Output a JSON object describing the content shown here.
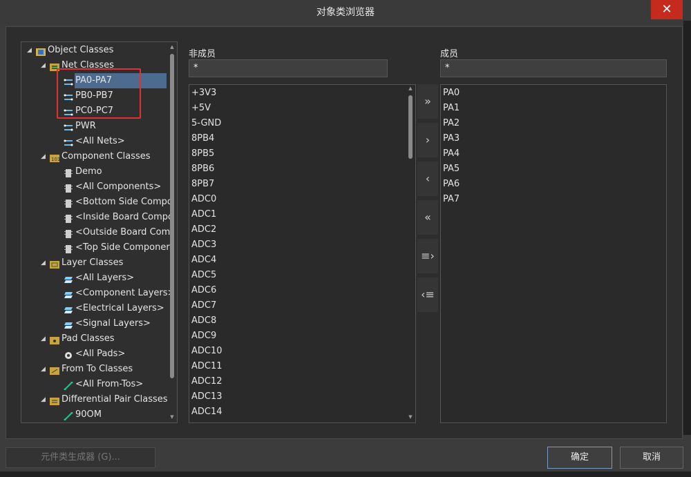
{
  "window": {
    "title": "对象类浏览器",
    "close": "✕"
  },
  "tree": {
    "rows": [
      {
        "label": "Object Classes",
        "exp": "◢",
        "icon": "root"
      },
      {
        "label": "Net Classes",
        "exp": "◢",
        "icon": "netfolder"
      },
      {
        "label": "PA0-PA7",
        "icon": "net",
        "selected": true
      },
      {
        "label": "PB0-PB7",
        "icon": "net"
      },
      {
        "label": "PC0-PC7",
        "icon": "net"
      },
      {
        "label": "PWR",
        "icon": "net"
      },
      {
        "label": "<All Nets>",
        "icon": "net"
      },
      {
        "label": "Component Classes",
        "exp": "◢",
        "icon": "compfolder"
      },
      {
        "label": "Demo",
        "icon": "comp"
      },
      {
        "label": "<All Components>",
        "icon": "comp"
      },
      {
        "label": "<Bottom Side Compo",
        "icon": "comp"
      },
      {
        "label": "<Inside Board Compo",
        "icon": "comp"
      },
      {
        "label": "<Outside Board Com",
        "icon": "comp"
      },
      {
        "label": "<Top Side Componer",
        "icon": "comp"
      },
      {
        "label": "Layer Classes",
        "exp": "◢",
        "icon": "layerfolder"
      },
      {
        "label": "<All Layers>",
        "icon": "layer"
      },
      {
        "label": "<Component Layers>",
        "icon": "layer"
      },
      {
        "label": "<Electrical Layers>",
        "icon": "layer"
      },
      {
        "label": "<Signal Layers>",
        "icon": "layer"
      },
      {
        "label": "Pad Classes",
        "exp": "◢",
        "icon": "padfolder"
      },
      {
        "label": "<All Pads>",
        "icon": "pad"
      },
      {
        "label": "From To Classes",
        "exp": "◢",
        "icon": "fromfolder"
      },
      {
        "label": "<All From-Tos>",
        "icon": "fromto"
      },
      {
        "label": "Differential Pair Classes",
        "exp": "◢",
        "icon": "difffolder"
      },
      {
        "label": "90OM",
        "icon": "fromto"
      }
    ]
  },
  "nonmembers": {
    "label": "非成员",
    "filter": "*",
    "items": [
      "+3V3",
      "+5V",
      "5-GND",
      "8PB4",
      "8PB5",
      "8PB6",
      "8PB7",
      "ADC0",
      "ADC1",
      "ADC2",
      "ADC3",
      "ADC4",
      "ADC5",
      "ADC6",
      "ADC7",
      "ADC8",
      "ADC9",
      "ADC10",
      "ADC11",
      "ADC12",
      "ADC13",
      "ADC14"
    ]
  },
  "members": {
    "label": "成员",
    "filter": "*",
    "items": [
      "PA0",
      "PA1",
      "PA2",
      "PA3",
      "PA4",
      "PA5",
      "PA6",
      "PA7"
    ]
  },
  "move_buttons": [
    {
      "name": "add-all-button",
      "glyph": "»"
    },
    {
      "name": "add-selected-button",
      "glyph": "›"
    },
    {
      "name": "remove-selected-button",
      "glyph": "‹"
    },
    {
      "name": "remove-all-button",
      "glyph": "«"
    },
    {
      "name": "add-filtered-button",
      "glyph": "≡›"
    },
    {
      "name": "remove-filtered-button",
      "glyph": "‹≡"
    }
  ],
  "footer": {
    "generator": "元件类生成器 (G)...",
    "ok": "确定",
    "cancel": "取消"
  },
  "colors": {
    "selection": "#4d6b8e",
    "highlight": "#e33030",
    "close": "#c42b1c"
  }
}
